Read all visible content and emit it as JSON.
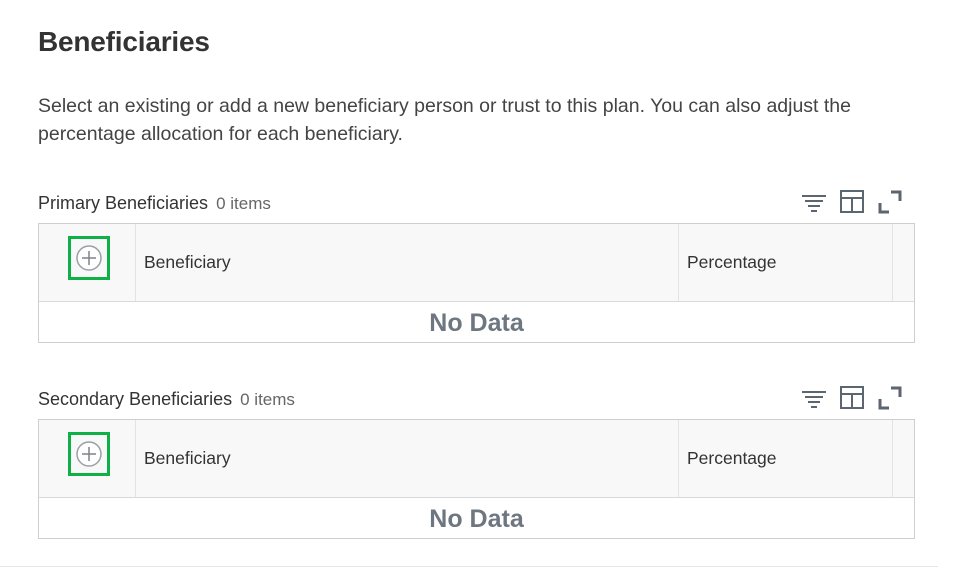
{
  "page": {
    "title": "Beneficiaries",
    "description": "Select an existing or add a new beneficiary person or trust to this plan. You can also adjust the percentage allocation for each beneficiary."
  },
  "primary": {
    "title": "Primary Beneficiaries",
    "count": "0 items",
    "columns": {
      "beneficiary": "Beneficiary",
      "percentage": "Percentage"
    },
    "empty_text": "No Data"
  },
  "secondary": {
    "title": "Secondary Beneficiaries",
    "count": "0 items",
    "columns": {
      "beneficiary": "Beneficiary",
      "percentage": "Percentage"
    },
    "empty_text": "No Data"
  },
  "icons": {
    "filter": "filter-icon",
    "columns": "columns-icon",
    "expand": "expand-icon",
    "add": "add-row-icon"
  },
  "colors": {
    "highlight": "#10b048",
    "text": "#333333",
    "muted": "#6e7780",
    "icon": "#5c6670"
  }
}
